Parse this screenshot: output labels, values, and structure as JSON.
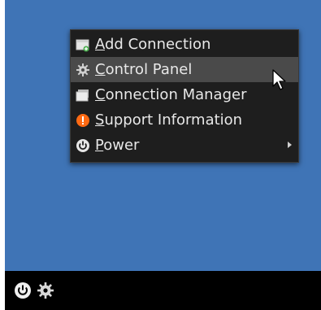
{
  "colors": {
    "desktop": "#3f74b6",
    "support_icon": "#ff6a13"
  },
  "menu": {
    "items": [
      {
        "label": "Add Connection",
        "icon": "add-connection-icon",
        "mnemonic": "A",
        "rest": "dd Connection"
      },
      {
        "label": "Control Panel",
        "icon": "gear-icon",
        "mnemonic": "C",
        "rest": "ontrol Panel",
        "active": true
      },
      {
        "label": "Connection Manager",
        "icon": "window-icon",
        "mnemonic": "C",
        "rest": "onnection Manager"
      },
      {
        "label": "Support Information",
        "icon": "info-icon",
        "mnemonic": "S",
        "rest": "upport Information"
      },
      {
        "label": "Power",
        "icon": "power-icon",
        "mnemonic": "P",
        "rest": "ower",
        "submenu": true
      }
    ]
  },
  "taskbar": {
    "icons": [
      "power-icon",
      "gear-icon"
    ]
  }
}
